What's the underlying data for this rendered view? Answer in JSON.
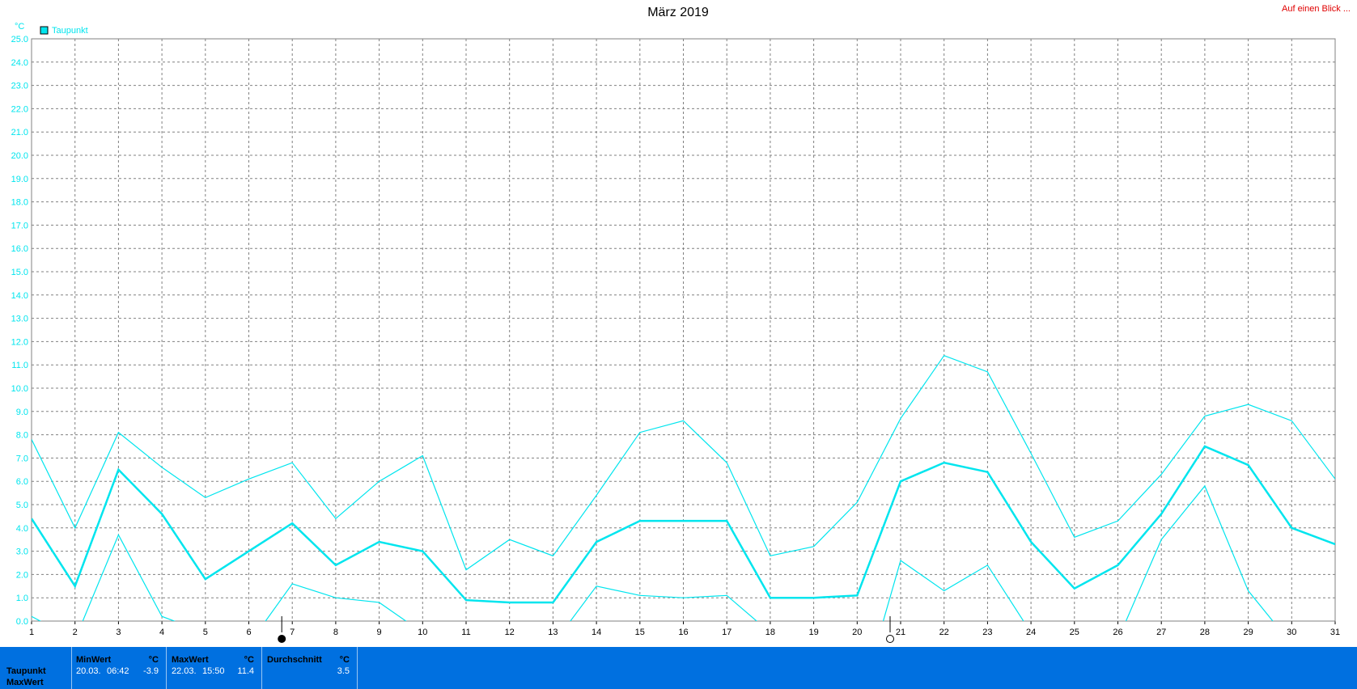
{
  "page": {
    "title": "März 2019",
    "corner_link": "Auf einen Blick ...",
    "colors": {
      "series": "#00e5ee",
      "grid": "#808080",
      "stats_bg": "#0070e0"
    }
  },
  "chart_data": {
    "type": "line",
    "title": "März 2019",
    "ylabel": "°C",
    "ylim": [
      0,
      25
    ],
    "grid": true,
    "legend": "top-left",
    "x": [
      1,
      2,
      3,
      4,
      5,
      6,
      7,
      8,
      9,
      10,
      11,
      12,
      13,
      14,
      15,
      16,
      17,
      18,
      19,
      20,
      21,
      22,
      23,
      24,
      25,
      26,
      27,
      28,
      29,
      30,
      31
    ],
    "x_tick_labels": [
      "1",
      "2",
      "3",
      "4",
      "5",
      "6",
      "7",
      "8",
      "9",
      "10",
      "11",
      "12",
      "13",
      "14",
      "15",
      "16",
      "17",
      "18",
      "19",
      "20",
      "21",
      "22",
      "23",
      "24",
      "25",
      "26",
      "27",
      "28",
      "29",
      "30",
      "31"
    ],
    "y_tick_labels": [
      "0.0",
      "1.0",
      "2.0",
      "3.0",
      "4.0",
      "5.0",
      "6.0",
      "7.0",
      "8.0",
      "9.0",
      "10.0",
      "11.0",
      "12.0",
      "13.0",
      "14.0",
      "15.0",
      "16.0",
      "17.0",
      "18.0",
      "19.0",
      "20.0",
      "21.0",
      "22.0",
      "23.0",
      "24.0",
      "25.0"
    ],
    "series": [
      {
        "name": "Taupunkt",
        "role": "mean",
        "values": [
          4.4,
          1.5,
          6.5,
          4.6,
          1.8,
          3.0,
          4.2,
          2.4,
          3.4,
          3.0,
          0.9,
          0.8,
          0.8,
          3.4,
          4.3,
          4.3,
          4.3,
          1.0,
          1.0,
          1.1,
          6.0,
          6.8,
          6.4,
          3.4,
          1.4,
          2.4,
          4.6,
          7.5,
          6.7,
          4.0,
          3.3
        ]
      },
      {
        "role": "max",
        "values": [
          7.8,
          4.0,
          8.1,
          6.6,
          5.3,
          6.1,
          6.8,
          4.4,
          6.0,
          7.1,
          2.2,
          3.5,
          2.8,
          5.4,
          8.1,
          8.6,
          6.8,
          2.8,
          3.2,
          5.1,
          8.7,
          11.4,
          10.7,
          7.2,
          3.6,
          4.3,
          6.3,
          8.8,
          9.3,
          8.6,
          6.1
        ]
      },
      {
        "role": "min",
        "values": [
          0.2,
          -0.8,
          3.7,
          0.2,
          -0.5,
          -1.0,
          1.6,
          1.0,
          0.8,
          -0.5,
          -1.5,
          -2.0,
          -1.0,
          1.5,
          1.1,
          1.0,
          1.1,
          -0.5,
          -3.0,
          -3.9,
          2.6,
          1.3,
          2.4,
          -0.5,
          -2.0,
          -0.8,
          3.5,
          5.8,
          1.3,
          -1.0,
          -1.5
        ]
      }
    ],
    "markers": [
      {
        "day": 7,
        "icon": "new-moon-icon"
      },
      {
        "day": 21,
        "icon": "full-moon-icon"
      }
    ]
  },
  "stats": {
    "row_labels": [
      "Taupunkt",
      "MaxWert"
    ],
    "min": {
      "header": "MinWert",
      "unit": "°C",
      "date": "20.03.",
      "time": "06:42",
      "value": "-3.9"
    },
    "max": {
      "header": "MaxWert",
      "unit": "°C",
      "date": "22.03.",
      "time": "15:50",
      "value": "11.4"
    },
    "avg": {
      "header": "Durchschnitt",
      "unit": "°C",
      "value": "3.5"
    }
  }
}
